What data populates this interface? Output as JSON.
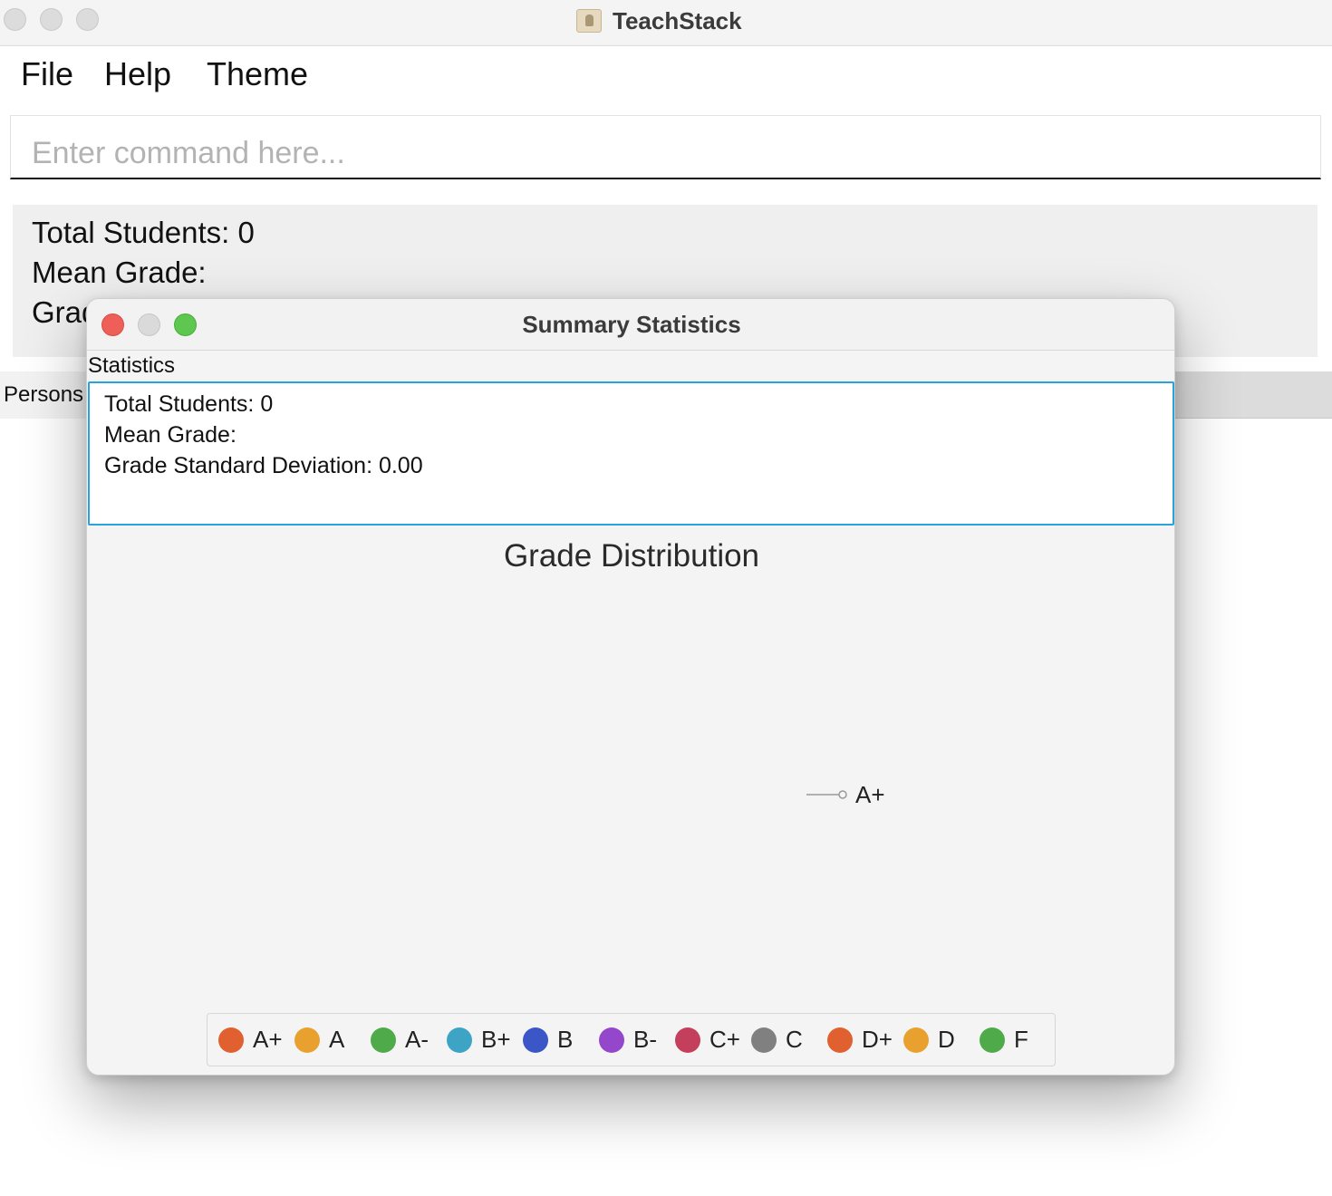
{
  "window": {
    "title": "TeachStack"
  },
  "menu": {
    "file": "File",
    "help": "Help",
    "theme": "Theme"
  },
  "command": {
    "placeholder": "Enter command here..."
  },
  "background_stats": {
    "total_students": "Total Students: 0",
    "mean_grade": "Mean Grade:",
    "grade_sd_partial": "Grad"
  },
  "tabs": {
    "persons": "Persons"
  },
  "popup": {
    "title": "Summary Statistics",
    "section_label": "Statistics",
    "total_students": "Total Students: 0",
    "mean_grade": "Mean Grade:",
    "grade_sd": "Grade Standard Deviation: 0.00"
  },
  "chart_data": {
    "type": "pie",
    "title": "Grade Distribution",
    "categories": [
      "A+",
      "A",
      "A-",
      "B+",
      "B",
      "B-",
      "C+",
      "C",
      "D+",
      "D",
      "F"
    ],
    "values": [
      0,
      0,
      0,
      0,
      0,
      0,
      0,
      0,
      0,
      0,
      0
    ],
    "slice_labels": [
      "A+"
    ],
    "legend_placement": "bottom",
    "colors": [
      "#e0602f",
      "#e8a12f",
      "#4fab4a",
      "#3ea4c6",
      "#3a56c7",
      "#9547cc",
      "#c43f5b",
      "#808080",
      "#e0602f",
      "#e8a12f",
      "#4fab4a"
    ]
  }
}
